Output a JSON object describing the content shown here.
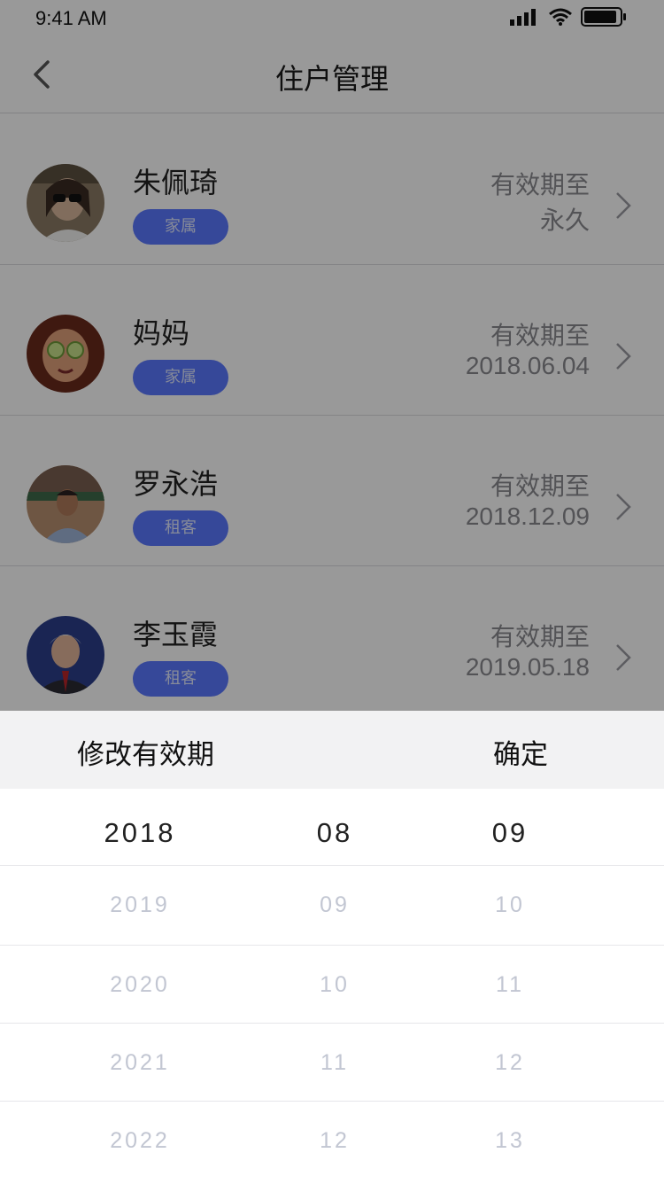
{
  "status_bar": {
    "time": "9:41 AM"
  },
  "nav": {
    "title": "住户管理"
  },
  "residents": [
    {
      "name": "朱佩琦",
      "tag": "家属",
      "expiry_label": "有效期至",
      "expiry_value": "永久"
    },
    {
      "name": "妈妈",
      "tag": "家属",
      "expiry_label": "有效期至",
      "expiry_value": "2018.06.04"
    },
    {
      "name": "罗永浩",
      "tag": "租客",
      "expiry_label": "有效期至",
      "expiry_value": "2018.12.09"
    },
    {
      "name": "李玉霞",
      "tag": "租客",
      "expiry_label": "有效期至",
      "expiry_value": "2019.05.18"
    }
  ],
  "picker_sheet": {
    "title": "修改有效期",
    "confirm_label": "确定",
    "selected": {
      "year": "2018",
      "month": "08",
      "day": "09"
    },
    "options": [
      {
        "year": "2019",
        "month": "09",
        "day": "10"
      },
      {
        "year": "2020",
        "month": "10",
        "day": "11"
      },
      {
        "year": "2021",
        "month": "11",
        "day": "12"
      },
      {
        "year": "2022",
        "month": "12",
        "day": "13"
      }
    ]
  },
  "colors": {
    "tag_bg": "#5b79ff",
    "overlay": "rgba(0,0,0,0.40)",
    "option_text": "#c2c6d2"
  }
}
